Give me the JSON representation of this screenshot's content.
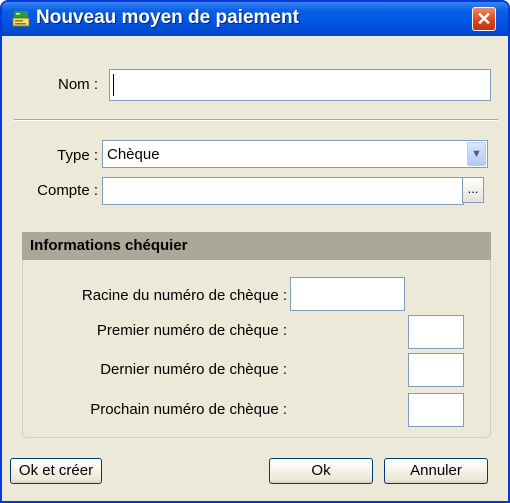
{
  "window": {
    "title": "Nouveau moyen de paiement",
    "title_icon": "payment-icon",
    "close_label": "✕"
  },
  "form": {
    "name_label": "Nom :",
    "name_value": "",
    "type_label": "Type :",
    "type_value": "Chèque",
    "account_label": "Compte :",
    "account_value": "",
    "account_button_label": "..."
  },
  "checkbook": {
    "title": "Informations chéquier",
    "root_label": "Racine du numéro de chèque :",
    "root_value": "",
    "first_label": "Premier numéro de chèque :",
    "first_value": "",
    "last_label": "Dernier numéro de chèque :",
    "last_value": "",
    "next_label": "Prochain numéro de chèque :",
    "next_value": ""
  },
  "buttons": {
    "ok_create": "Ok et créer",
    "ok": "Ok",
    "cancel": "Annuler"
  }
}
